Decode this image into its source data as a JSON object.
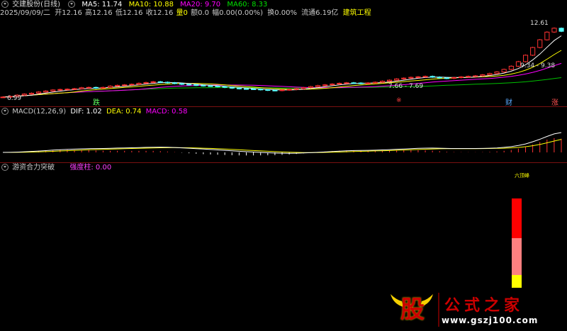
{
  "header1": {
    "title": "交建股份(日线)",
    "ma5": "MA5: 11.74",
    "ma10": "MA10: 10.88",
    "ma20": "MA20: 9.70",
    "ma60": "MA60: 8.33"
  },
  "header2": {
    "date": "2025/09/09/二",
    "open": "开12.16",
    "high": "高12.16",
    "low": "低12.16",
    "close": "收12.16",
    "volume": "量0",
    "amount": "额0.0",
    "change": "幅0.00(0.00%)",
    "turnover": "换0.00%",
    "float": "流通6.19亿",
    "sector": "建筑工程"
  },
  "price_annotations": {
    "high": "12.61",
    "low": "6.99",
    "mid1": "9.34 - 9.38",
    "mid2": "7.66 - 7.69",
    "tag_die": "跌",
    "tag_dot": "※",
    "tag_cai": "财",
    "tag_zhang": "涨"
  },
  "macd_header": {
    "title": "MACD(12,26,9)",
    "dif": "DIF: 1.02",
    "dea": "DEA: 0.74",
    "macd": "MACD: 0.58"
  },
  "ind_header": {
    "title": "游资合力突破",
    "label": "强度柱: 0.00",
    "top_label": "六顶峰"
  },
  "watermark": {
    "main": "股",
    "text": "公式之家",
    "url": "www.gszj100.com"
  },
  "colors": {
    "up": "#ff3232",
    "down": "#54ffff",
    "ma5": "#ffffff",
    "ma10": "#ffff00",
    "ma20": "#ff00ff",
    "ma60": "#00c000"
  },
  "chart_data": [
    {
      "type": "candlestick",
      "title": "交建股份(日线)",
      "ylim": [
        6.99,
        12.61
      ],
      "close": [
        7.05,
        7.1,
        7.2,
        7.28,
        7.35,
        7.44,
        7.52,
        7.6,
        7.64,
        7.66,
        7.7,
        7.78,
        7.8,
        7.74,
        7.8,
        7.9,
        7.96,
        8.0,
        8.04,
        8.12,
        8.18,
        8.24,
        8.2,
        8.16,
        8.1,
        8.04,
        8.0,
        7.96,
        7.92,
        7.9,
        7.86,
        7.8,
        7.74,
        7.7,
        7.68,
        7.66,
        7.62,
        7.58,
        7.56,
        7.6,
        7.64,
        7.7,
        7.78,
        7.86,
        7.94,
        8.0,
        8.06,
        8.12,
        8.16,
        8.14,
        8.1,
        8.14,
        8.2,
        8.28,
        8.36,
        8.46,
        8.52,
        8.58,
        8.62,
        8.66,
        8.6,
        8.54,
        8.5,
        8.56,
        8.62,
        8.66,
        8.7,
        8.78,
        8.88,
        9.0,
        9.2,
        9.45,
        9.8,
        10.3,
        10.9,
        11.5,
        12.1,
        12.4,
        12.16
      ],
      "ma_values": {
        "MA5": 11.74,
        "MA10": 10.88,
        "MA20": 9.7,
        "MA60": 8.33
      }
    },
    {
      "type": "bar",
      "title": "MACD(12,26,9)",
      "series": [
        {
          "name": "DIF",
          "last": 1.02
        },
        {
          "name": "DEA",
          "last": 0.74
        },
        {
          "name": "MACD",
          "last": 0.58
        }
      ]
    },
    {
      "type": "bar",
      "title": "游资合力突破",
      "series": [
        {
          "name": "强度柱",
          "last": 0.0
        }
      ]
    }
  ]
}
